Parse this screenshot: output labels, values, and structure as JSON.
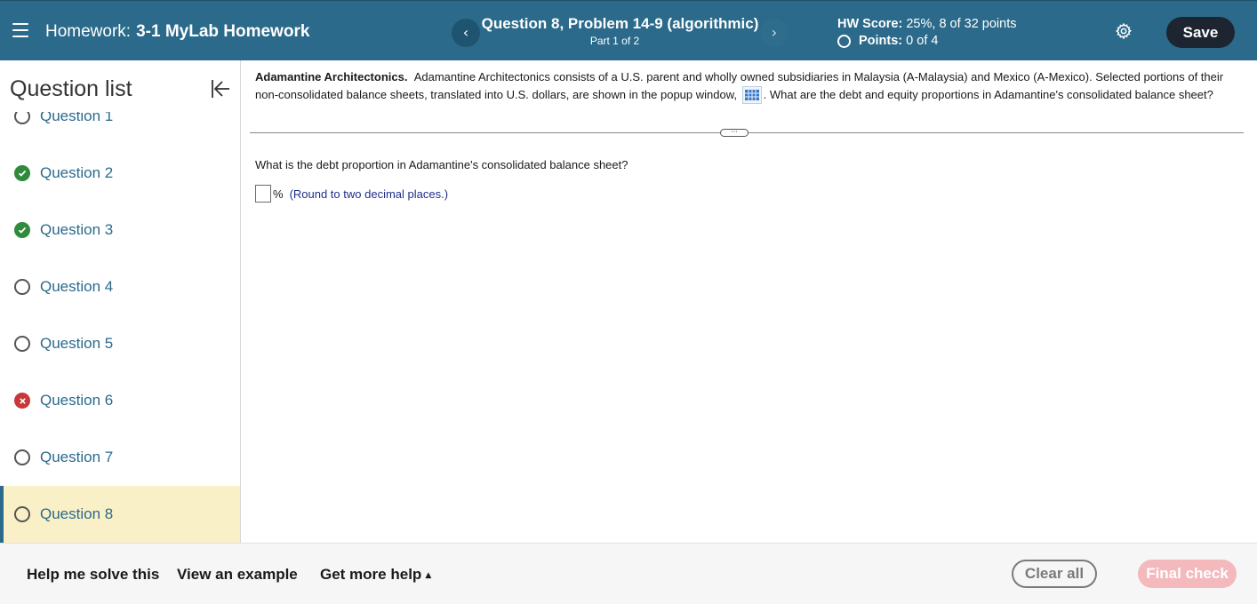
{
  "header": {
    "title_prefix": "Homework:",
    "title_name": "3-1 MyLab Homework",
    "question_title": "Question 8, Problem 14-9 (algorithmic)",
    "question_part": "Part 1 of 2",
    "prev_icon": "chevron-left",
    "next_icon": "chevron-right",
    "hw_score_label": "HW Score:",
    "hw_score_value": "25%, 8 of 32 points",
    "points_label": "Points:",
    "points_value": "0 of 4",
    "save_label": "Save",
    "colors": {
      "bar": "#2b6a8a",
      "save_button": "#1c2530"
    }
  },
  "sidebar": {
    "title": "Question list",
    "items": [
      {
        "label": "Question 1",
        "status": "open"
      },
      {
        "label": "Question 2",
        "status": "correct"
      },
      {
        "label": "Question 3",
        "status": "correct"
      },
      {
        "label": "Question 4",
        "status": "open"
      },
      {
        "label": "Question 5",
        "status": "open"
      },
      {
        "label": "Question 6",
        "status": "incorrect"
      },
      {
        "label": "Question 7",
        "status": "open"
      },
      {
        "label": "Question 8",
        "status": "open",
        "active": true
      }
    ],
    "colors": {
      "active_bg": "#faf0c8",
      "correct": "#2f8a3c",
      "incorrect": "#c8383b",
      "link": "#2a6a8c"
    }
  },
  "problem": {
    "bold_intro": "Adamantine Architectonics.",
    "text_part1": "Adamantine Architectonics consists of a U.S. parent and wholly owned subsidiaries in Malaysia (A-Malaysia) and Mexico (A-Mexico). Selected portions of their non-consolidated balance sheets, translated into U.S. dollars, are shown in the popup window,",
    "text_part2": ". What are the debt and equity proportions in Adamantine's consolidated balance sheet?",
    "data_icon": "table-grid-icon"
  },
  "question": {
    "prompt": "What is the debt proportion in Adamantine's consolidated balance sheet?",
    "answer_value": "",
    "unit": "%",
    "hint": "(Round to two decimal places.)"
  },
  "footer": {
    "help_label": "Help me solve this",
    "example_label": "View an example",
    "more_help_label": "Get more help",
    "clear_label": "Clear all",
    "final_label": "Final check"
  }
}
